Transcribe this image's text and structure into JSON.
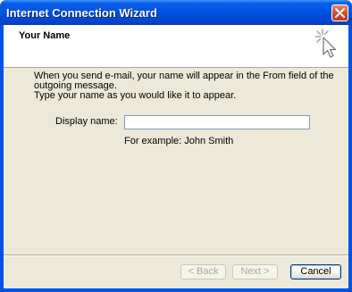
{
  "window": {
    "title": "Internet Connection Wizard"
  },
  "header": {
    "title": "Your Name",
    "icon": "wizard-cursor-icon"
  },
  "body": {
    "instructions": "When you send e-mail, your name will appear in the From field of the outgoing message.\nType your name as you would like it to appear.",
    "display_name_label": "Display name:",
    "display_name_value": "",
    "example_hint": "For example: John Smith"
  },
  "buttons": {
    "back": "< Back",
    "next": "Next >",
    "cancel": "Cancel"
  },
  "colors": {
    "titlebar": "#0054e3",
    "client": "#ece9d8",
    "close_button": "#d5482b"
  }
}
